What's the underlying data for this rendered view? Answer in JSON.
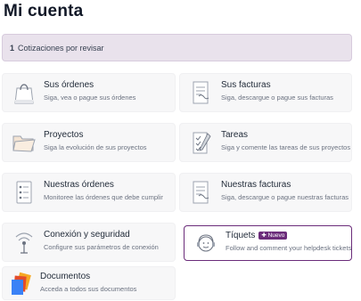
{
  "page": {
    "title": "Mi cuenta"
  },
  "alert": {
    "count": "1",
    "text": "Cotizaciones por revisar"
  },
  "cards": [
    {
      "title": "Sus órdenes",
      "desc": "Siga, vea o pague sus órdenes",
      "icon": "shopping-bag-icon"
    },
    {
      "title": "Sus facturas",
      "desc": "Siga, descargue o pague sus facturas",
      "icon": "invoice-icon"
    },
    {
      "title": "Proyectos",
      "desc": "Siga la evolución de sus proyectos",
      "icon": "folder-icon"
    },
    {
      "title": "Tareas",
      "desc": "Siga y comente las tareas de sus proyectos",
      "icon": "task-checklist-icon"
    },
    {
      "title": "Nuestras órdenes",
      "desc": "Monitoree las órdenes que debe cumplir",
      "icon": "order-list-icon"
    },
    {
      "title": "Nuestras facturas",
      "desc": "Siga, descargue o pague nuestras facturas",
      "icon": "invoice-icon"
    },
    {
      "title": "Conexión y seguridad",
      "desc": "Configure sus parámetros de conexión",
      "icon": "connection-icon"
    },
    {
      "title": "Tíquets",
      "badge": "✚ Nuevo",
      "desc": "Follow and comment your helpdesk tickets",
      "icon": "helpdesk-icon"
    },
    {
      "title": "Documentos",
      "desc": "Acceda a todos sus documentos",
      "icon": "documents-icon"
    }
  ],
  "colors": {
    "accent": "#6b2c7a",
    "alert_bg": "#e9e2ec",
    "card_bg": "#f7f7f8"
  }
}
